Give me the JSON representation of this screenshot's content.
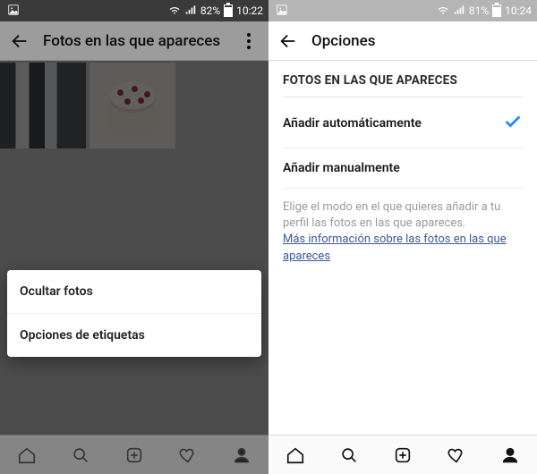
{
  "left": {
    "status": {
      "battery_pct": "82%",
      "time": "10:22"
    },
    "appbar": {
      "title": "Fotos en las que apareces"
    },
    "action_sheet": {
      "hide_photos": "Ocultar fotos",
      "tag_options": "Opciones de etiquetas"
    }
  },
  "right": {
    "status": {
      "battery_pct": "81%",
      "time": "10:24"
    },
    "appbar": {
      "title": "Opciones"
    },
    "section_title": "FOTOS EN LAS QUE APARECES",
    "options": {
      "auto": "Añadir automáticamente",
      "manual": "Añadir manualmente"
    },
    "help_text": "Elige el modo en el que quieres añadir a tu perfil las fotos en las que apareces.",
    "help_link": "Más información sobre las fotos en las que apareces"
  }
}
